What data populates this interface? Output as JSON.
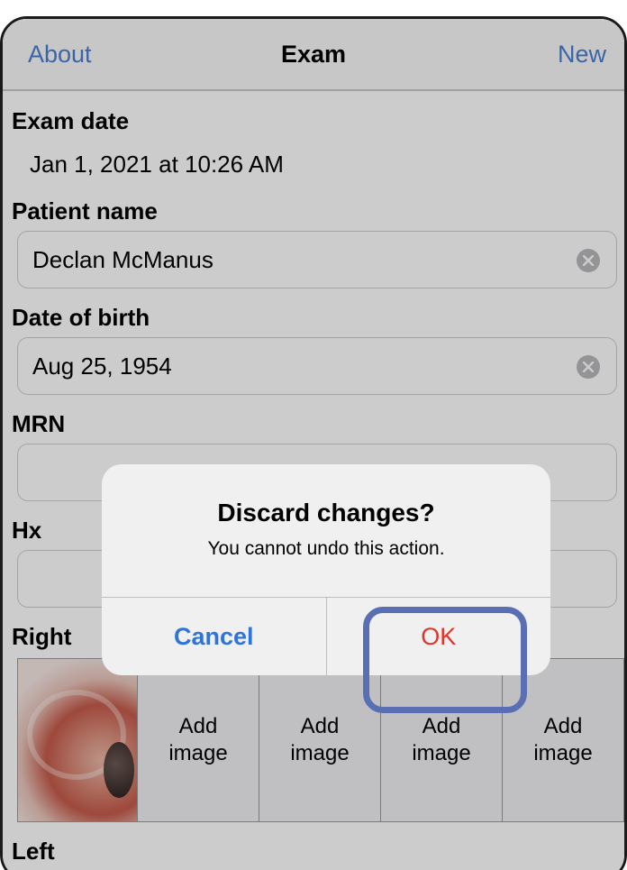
{
  "nav": {
    "left": "About",
    "title": "Exam",
    "right": "New"
  },
  "exam_date": {
    "label": "Exam date",
    "value": "Jan 1, 2021 at 10:26 AM"
  },
  "patient_name": {
    "label": "Patient name",
    "value": "Declan McManus"
  },
  "date_of_birth": {
    "label": "Date of birth",
    "value": "Aug 25, 1954"
  },
  "mrn": {
    "label": "MRN",
    "value": ""
  },
  "hx": {
    "label": "Hx",
    "value": ""
  },
  "right_eye": {
    "label": "Right",
    "add_images": [
      {
        "line1": "Add",
        "line2": "image"
      },
      {
        "line1": "Add",
        "line2": "image"
      },
      {
        "line1": "Add",
        "line2": "image"
      },
      {
        "line1": "Add",
        "line2": "image"
      }
    ]
  },
  "left_eye": {
    "label": "Left"
  },
  "alert": {
    "title": "Discard changes?",
    "message": "You cannot undo this action.",
    "cancel_label": "Cancel",
    "ok_label": "OK"
  },
  "colors": {
    "accent": "#2f74d8",
    "destructive": "#e0352b",
    "highlight": "#5a6fb3"
  }
}
